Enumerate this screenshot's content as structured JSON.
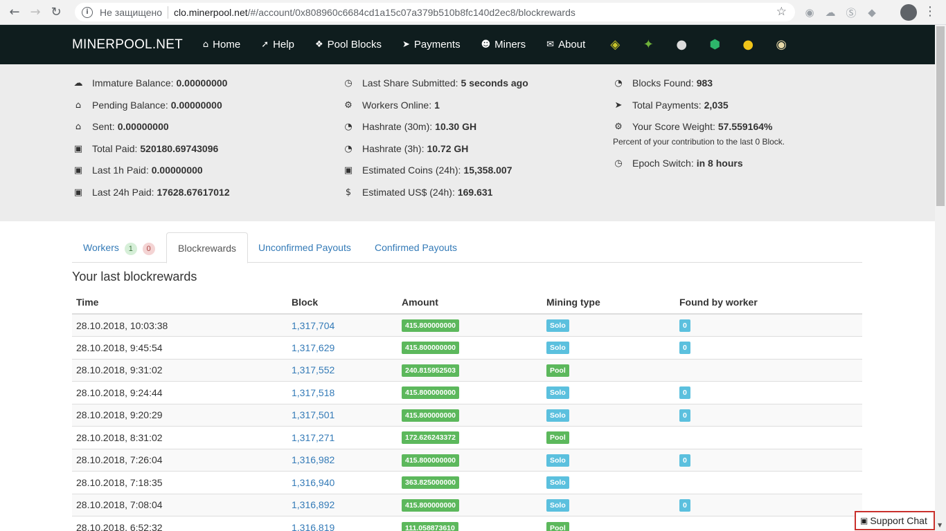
{
  "browser": {
    "not_secure": "Не защищено",
    "url_host": "clo.minerpool.net",
    "url_path": "/#/account/0x808960c6684cd1a15c07a379b510b8fc140d2ec8/blockrewards"
  },
  "navbar": {
    "brand": "MINERPOOL.NET",
    "items": [
      {
        "label": "Home",
        "icon": "home-icon"
      },
      {
        "label": "Help",
        "icon": "rocket-icon"
      },
      {
        "label": "Pool Blocks",
        "icon": "cubes-icon"
      },
      {
        "label": "Payments",
        "icon": "paper-plane-icon"
      },
      {
        "label": "Miners",
        "icon": "users-icon"
      },
      {
        "label": "About",
        "icon": "comments-icon"
      }
    ]
  },
  "stats": {
    "left": [
      {
        "label": "Immature Balance:",
        "value": "0.00000000",
        "icon": "cloud-icon"
      },
      {
        "label": "Pending Balance:",
        "value": "0.00000000",
        "icon": "bank-icon"
      },
      {
        "label": "Sent:",
        "value": "0.00000000",
        "icon": "bank-icon"
      },
      {
        "label": "Total Paid:",
        "value": "520180.69743096",
        "icon": "money-icon"
      },
      {
        "label": "Last 1h Paid:",
        "value": "0.00000000",
        "icon": "money-icon"
      },
      {
        "label": "Last 24h Paid:",
        "value": "17628.67617012",
        "icon": "money-icon"
      }
    ],
    "middle": [
      {
        "label": "Last Share Submitted:",
        "value": "5 seconds ago",
        "icon": "clock-icon"
      },
      {
        "label": "Workers Online:",
        "value": "1",
        "icon": "gears-icon"
      },
      {
        "label": "Hashrate (30m):",
        "value": "10.30 GH",
        "icon": "dashboard-icon"
      },
      {
        "label": "Hashrate (3h):",
        "value": "10.72 GH",
        "icon": "dashboard-icon"
      },
      {
        "label": "Estimated Coins (24h):",
        "value": "15,358.007",
        "icon": "money-icon"
      },
      {
        "label": "Estimated US$ (24h):",
        "value": "169.631",
        "icon": "dollar-icon"
      }
    ],
    "right": [
      {
        "label": "Blocks Found:",
        "value": "983",
        "icon": "dashboard-icon"
      },
      {
        "label": "Total Payments:",
        "value": "2,035",
        "icon": "paper-plane-icon"
      },
      {
        "label": "Your Score Weight:",
        "value": "57.559164%",
        "icon": "gears-icon"
      },
      {
        "label": "Epoch Switch:",
        "value": "in 8 hours",
        "icon": "clock-icon"
      }
    ],
    "score_note": "Percent of your contribution to the last 0 Block."
  },
  "tabs": {
    "workers": "Workers",
    "workers_online": "1",
    "workers_offline": "0",
    "blockrewards": "Blockrewards",
    "unconfirmed": "Unconfirmed Payouts",
    "confirmed": "Confirmed Payouts"
  },
  "section_title": "Your last blockrewards",
  "table": {
    "headers": [
      "Time",
      "Block",
      "Amount",
      "Mining type",
      "Found by worker"
    ],
    "rows": [
      {
        "time": "28.10.2018, 10:03:38",
        "block": "1,317,704",
        "amount": "415.800000000",
        "type": "Solo",
        "worker": "0"
      },
      {
        "time": "28.10.2018, 9:45:54",
        "block": "1,317,629",
        "amount": "415.800000000",
        "type": "Solo",
        "worker": "0"
      },
      {
        "time": "28.10.2018, 9:31:02",
        "block": "1,317,552",
        "amount": "240.815952503",
        "type": "Pool",
        "worker": ""
      },
      {
        "time": "28.10.2018, 9:24:44",
        "block": "1,317,518",
        "amount": "415.800000000",
        "type": "Solo",
        "worker": "0"
      },
      {
        "time": "28.10.2018, 9:20:29",
        "block": "1,317,501",
        "amount": "415.800000000",
        "type": "Solo",
        "worker": "0"
      },
      {
        "time": "28.10.2018, 8:31:02",
        "block": "1,317,271",
        "amount": "172.626243372",
        "type": "Pool",
        "worker": ""
      },
      {
        "time": "28.10.2018, 7:26:04",
        "block": "1,316,982",
        "amount": "415.800000000",
        "type": "Solo",
        "worker": "0"
      },
      {
        "time": "28.10.2018, 7:18:35",
        "block": "1,316,940",
        "amount": "363.825000000",
        "type": "Solo",
        "worker": ""
      },
      {
        "time": "28.10.2018, 7:08:04",
        "block": "1,316,892",
        "amount": "415.800000000",
        "type": "Solo",
        "worker": "0"
      },
      {
        "time": "28.10.2018, 6:52:32",
        "block": "1,316,819",
        "amount": "111.058873610",
        "type": "Pool",
        "worker": ""
      }
    ]
  },
  "support_chat": "Support Chat",
  "colors": {
    "navbar_bg": "#0f1d1e",
    "stats_bg": "#ececec",
    "label_green": "#5cb85c",
    "label_blue": "#5bc0de",
    "link": "#337ab7"
  }
}
